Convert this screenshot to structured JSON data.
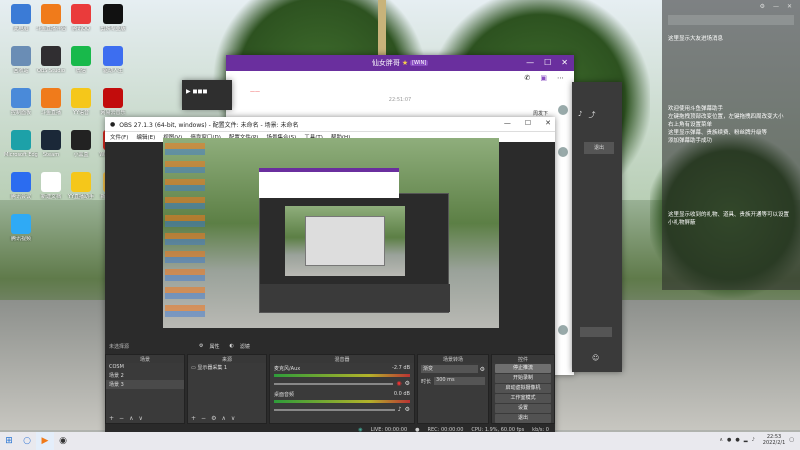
{
  "desktop_icons": [
    {
      "label": "此电脑",
      "color": "#3b7bd6"
    },
    {
      "label": "斗鱼直播伴侣",
      "color": "#f07b1b"
    },
    {
      "label": "腾讯QQ",
      "color": "#ea3b3b"
    },
    {
      "label": "剪映专业版",
      "color": "#111111"
    },
    {
      "label": "回收站",
      "color": "#6a8db5"
    },
    {
      "label": "OBS Studio",
      "color": "#302e31"
    },
    {
      "label": "微信",
      "color": "#18b94b"
    },
    {
      "label": "驱动人生",
      "color": "#3d6ef0"
    },
    {
      "label": "控制面板",
      "color": "#4a8ad9"
    },
    {
      "label": "斗鱼直播",
      "color": "#f07b1b"
    },
    {
      "label": "YY语音",
      "color": "#f5c71a"
    },
    {
      "label": "网易云音乐",
      "color": "#c20c0c"
    },
    {
      "label": "Microsoft Edge",
      "color": "#1da1a8"
    },
    {
      "label": "Steam",
      "color": "#1b2838"
    },
    {
      "label": "小黑盒",
      "color": "#222222"
    },
    {
      "label": "WPS Office",
      "color": "#d8281f"
    },
    {
      "label": "腾讯会议",
      "color": "#2b6cf0"
    },
    {
      "label": "新建文档",
      "color": "#ffffff"
    },
    {
      "label": "YY直播助手",
      "color": "#f5c71a"
    },
    {
      "label": "新建文件夹",
      "color": "#f2c14b"
    },
    {
      "label": "腾讯视频",
      "color": "#2faaf5"
    }
  ],
  "chat_window": {
    "title": "仙女胖哥",
    "badge": "[WIN]",
    "timestamp": "22:51:07",
    "side_label": "周发下",
    "link_text": "——"
  },
  "obs": {
    "title": "OBS 27.1.3 (64-bit, windows) - 配置文件: 未命名 - 场景: 未命名",
    "menu": [
      "文件(F)",
      "编辑(E)",
      "视图(V)",
      "停靠窗口(D)",
      "配置文件(P)",
      "场景集合(S)",
      "工具(T)",
      "帮助(H)"
    ],
    "active_source_label": "未选择源",
    "toolbar_buttons": [
      "属性",
      "滤镜"
    ],
    "docks": {
      "scenes": {
        "title": "场景",
        "items": [
          "COSM",
          "场景 2",
          "场景 3"
        ],
        "selected": 2
      },
      "sources": {
        "title": "来源",
        "items": [
          "显示器采集 1"
        ]
      },
      "mixer": {
        "title": "混音器",
        "channels": [
          {
            "name": "麦克风/Aux",
            "db": "-2.7 dB"
          },
          {
            "name": "桌面音频",
            "db": "0.0 dB"
          }
        ]
      },
      "transitions": {
        "title": "场景转场",
        "type": "渐变",
        "duration_label": "时长",
        "duration": "300 ms"
      },
      "controls": {
        "title": "控件",
        "buttons": [
          "停止推流",
          "开始录制",
          "启动虚拟摄像机",
          "工作室模式",
          "设置",
          "退出"
        ]
      }
    },
    "status": {
      "live": "LIVE: 00:00:00",
      "rec": "REC: 00:00:00",
      "cpu": "CPU: 1.9%, 60.00 fps",
      "kbps": "kb/s: 0"
    }
  },
  "right_panel": {
    "messages": [
      "这里显示大友进场消息",
      "欢迎使用斗鱼弹幕助手",
      "左键拖拽顶部改变位置，左键拖拽四周改变大小",
      "右上角有设置菜单",
      "这里显示弹幕、贵族续费、粉丝牌升级等",
      "添加弹幕助手成功",
      "这里显示收到的礼物、道具、贵族开通等可以设置小礼物屏蔽"
    ],
    "window_icons": [
      "gear-icon",
      "minimize-icon",
      "close-icon"
    ],
    "exit_button": "退出"
  },
  "taskbar": {
    "time": "22:53",
    "date": "2022/2/1"
  }
}
